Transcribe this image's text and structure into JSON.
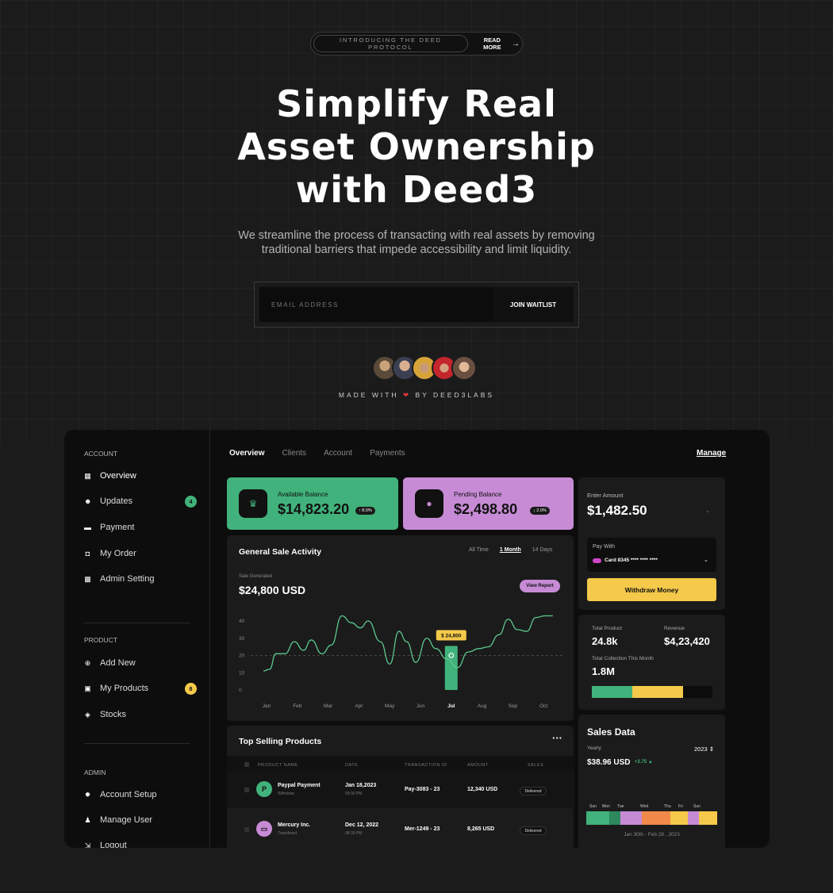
{
  "announcement": {
    "tag": "INTRODUCING THE DEED PROTOCOL",
    "link": "READ MORE"
  },
  "hero": {
    "title_line1": "Simplify Real",
    "title_line2": "Asset Ownership",
    "title_line3": "with Deed3",
    "subtitle_line1": "We streamline the process of transacting with real assets by removing",
    "subtitle_line2": "traditional barriers that impede accessibility and limit liquidity."
  },
  "waitlist": {
    "placeholder": "EMAIL ADDRESS",
    "button": "JOIN WAITLIST"
  },
  "credit": {
    "prefix": "MADE WITH",
    "suffix": "BY DEED3LABS"
  },
  "sidebar": {
    "account_label": "ACCOUNT",
    "account_items": [
      {
        "label": "Overview",
        "icon": "grid-icon"
      },
      {
        "label": "Updates",
        "icon": "smile-icon",
        "badge": "4"
      },
      {
        "label": "Payment",
        "icon": "wallet-icon"
      },
      {
        "label": "My Order",
        "icon": "bag-icon"
      },
      {
        "label": "Admin Setting",
        "icon": "settings-grid-icon"
      }
    ],
    "product_label": "PRODUCT",
    "product_items": [
      {
        "label": "Add New",
        "icon": "plus-circle-icon"
      },
      {
        "label": "My Products",
        "icon": "box-icon",
        "badge": "8"
      },
      {
        "label": "Stocks",
        "icon": "layers-icon"
      }
    ],
    "admin_label": "ADMIN",
    "admin_items": [
      {
        "label": "Account Setup",
        "icon": "gear-icon"
      },
      {
        "label": "Manage User",
        "icon": "users-icon"
      },
      {
        "label": "Logout",
        "icon": "logout-icon"
      }
    ]
  },
  "tabs": [
    "Overview",
    "Clients",
    "Account",
    "Payments"
  ],
  "manage": "Manage",
  "available": {
    "label": "Available Balance",
    "value": "$14,823.20",
    "change": "↑ 8.0%"
  },
  "pending": {
    "label": "Pending Balance",
    "value": "$2,498.80",
    "change": "↓ 2.0%"
  },
  "withdraw": {
    "label": "Enter Amount",
    "amount": "$1,482.50",
    "pay_label": "Pay With",
    "card": "Card 8345 **** **** ****",
    "button": "Withdraw Money"
  },
  "stats": {
    "total_product_label": "Total Product",
    "total_product": "24.8k",
    "revenue_label": "Revenue",
    "revenue": "$4,23,420",
    "collection_label": "Total Collection This Month",
    "collection": "1.8M"
  },
  "sales_data": {
    "title": "Sales Data",
    "period_label": "Yearly",
    "year": "2023",
    "value": "$38.96 USD",
    "change": "+2.75 ▲",
    "days": [
      "Sun",
      "Mon",
      "Tue",
      "Wed",
      "Thu",
      "Fri",
      "Sun"
    ],
    "range": "Jan 30th - Feb 28 , 2023"
  },
  "activity": {
    "title": "General Sale Activity",
    "filters": [
      "All Time",
      "1 Month",
      "14 Days"
    ],
    "generated_label": "Sale Generated",
    "generated_value": "$24,800 USD",
    "view_report": "View Report",
    "tooltip": "$ 24,800"
  },
  "chart_data": {
    "type": "line",
    "categories": [
      "Jan",
      "Feb",
      "Mar",
      "Apr",
      "May",
      "Jun",
      "Jul",
      "Aug",
      "Sep",
      "Oct"
    ],
    "y_ticks": [
      0,
      10,
      20,
      30,
      40
    ],
    "ylim": [
      0,
      40
    ],
    "reference_line": 20,
    "highlight": {
      "category": "Jul",
      "value": 20,
      "label": "$ 24,800"
    },
    "x": [
      -0.1,
      0.1,
      0.3,
      0.6,
      0.9,
      1.2,
      1.45,
      1.8,
      2.1,
      2.45,
      2.75,
      3.05,
      3.3,
      3.7,
      4.0,
      4.3,
      4.55,
      4.85,
      5.2,
      5.5,
      5.85,
      6.2,
      6.55,
      6.9,
      7.2,
      7.55,
      7.85,
      8.15,
      8.45,
      8.75,
      9.05,
      9.3
    ],
    "values": [
      11,
      12,
      21,
      21,
      28,
      23,
      29,
      21,
      26,
      43,
      39,
      36,
      40,
      28,
      15,
      34,
      28,
      16,
      30,
      24,
      18,
      13,
      22,
      24,
      25,
      32,
      41,
      35,
      34,
      42,
      43,
      43
    ]
  },
  "products": {
    "title": "Top Selling Products",
    "columns": [
      "PRODUCT NAME",
      "DATE",
      "TRANSACTION ID",
      "AMOUNT",
      "SALES"
    ],
    "rows": [
      {
        "name": "Paypal Payment",
        "sub": "Withdraw",
        "date": "Jan 18,2023",
        "time": "09:30 PM",
        "id": "Pay-3083 - 23",
        "amount": "12,340 USD",
        "status": "Delivered",
        "icon": "P"
      },
      {
        "name": "Mercury Inc.",
        "sub": "Transfered",
        "date": "Dec 12, 2022",
        "time": "08:30 PM",
        "id": "Mer-1249 - 23",
        "amount": "8,265 USD",
        "status": "Delivered",
        "icon": "▭"
      }
    ]
  },
  "colors": {
    "green": "#41b27b",
    "purple": "#c78bd6",
    "yellow": "#f5c94a",
    "orange": "#f0894a"
  }
}
